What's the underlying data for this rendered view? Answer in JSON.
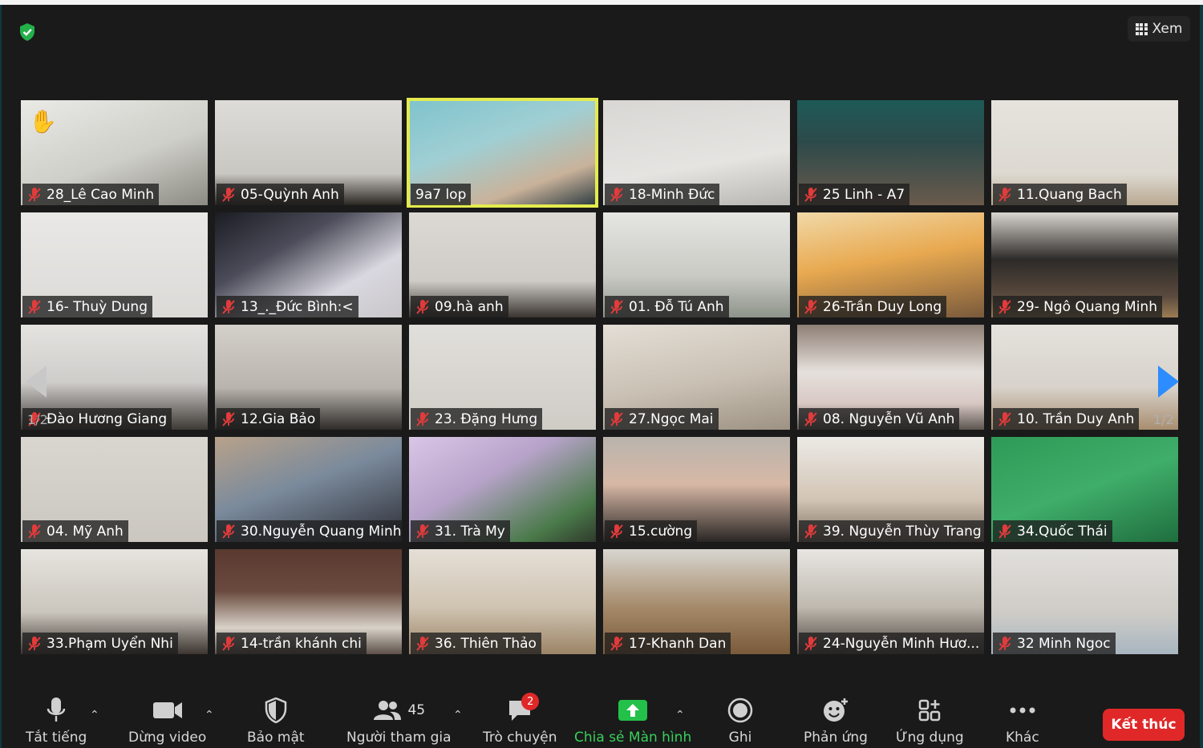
{
  "view_label": "Xem",
  "page_indicator": "1/2",
  "tiles": [
    {
      "name": "28_Lê Cao Minh",
      "bg": "linear-gradient(160deg,#e9e9e6 0%,#cfcfc9 55%,#8b8a83 100%)",
      "hand": true
    },
    {
      "name": "05-Quỳnh Anh",
      "bg": "linear-gradient(180deg,#dedcd8 0%,#c9c7c2 70%,#2a2622 100%)"
    },
    {
      "name": "9a7 lop",
      "bg": "linear-gradient(160deg,#7fc3cc 0%,#9fcfd4 40%,#c9b29a 75%,#2c3b40 100%)",
      "active": true
    },
    {
      "name": "18-Minh Đức",
      "bg": "linear-gradient(170deg,#d9d7d4 0%,#e6e4e1 60%,#b8b6b2 100%)"
    },
    {
      "name": "25 Linh - A7",
      "bg": "linear-gradient(180deg,#1d5a57 0%,#2d4a4a 40%,#6a5a4c 100%)"
    },
    {
      "name": "11.Quang Bach",
      "bg": "linear-gradient(180deg,#e6e3dd 0%,#ddd9d1 70%,#b9a991 100%)"
    },
    {
      "name": "16- Thuỳ Dung",
      "bg": "linear-gradient(180deg,#e9e8e6 0%,#dcdad7 100%)"
    },
    {
      "name": "13_._Đức Bình:<",
      "bg": "linear-gradient(150deg,#1c1c24 0%,#4c4c5a 35%,#d9d8e0 70%,#c8c6c8 100%)"
    },
    {
      "name": "09.hà anh",
      "bg": "linear-gradient(180deg,#dcd9d5 0%,#cfccc8 65%,#3a3430 100%)"
    },
    {
      "name": "01. Đỗ Tú Anh",
      "bg": "linear-gradient(180deg,#e6e6e2 0%,#c9cac4 60%,#8f948b 100%)"
    },
    {
      "name": "26-Trần Duy Long",
      "bg": "linear-gradient(170deg,#f1d9a8 0%,#e8a950 45%,#7a5a3c 100%)"
    },
    {
      "name": "29- Ngô Quang Minh",
      "bg": "linear-gradient(180deg,#d9d5cf 0%,#2c2a28 45%,#5b4a3e 80%,#9b7d54 100%)"
    },
    {
      "name": "Đào Hương Giang",
      "bg": "linear-gradient(180deg,#e4e3e0 0%,#cfcdca 55%,#3d3935 100%)"
    },
    {
      "name": "12.Gia Bảo",
      "bg": "linear-gradient(180deg,#d4d0ca 0%,#b9b4ad 60%,#2e2b29 100%)"
    },
    {
      "name": "23. Đặng Hưng",
      "bg": "linear-gradient(180deg,#e1dfdb 0%,#cfccc6 100%)"
    },
    {
      "name": "27.Ngọc Mai",
      "bg": "linear-gradient(170deg,#e3ded6 0%,#c9c0b3 55%,#9d9283 100%)"
    },
    {
      "name": "08. Nguyễn Vũ Anh",
      "bg": "linear-gradient(180deg,#8d7f74 0%,#e6e0dc 45%,#d8c8c4 75%,#5c5550 100%)"
    },
    {
      "name": "10. Trần Duy Anh",
      "bg": "linear-gradient(180deg,#e5e2dd 0%,#d7d2ca 60%,#a88d6e 100%)"
    },
    {
      "name": "04. Mỹ Anh",
      "bg": "linear-gradient(180deg,#d9d6d0 0%,#cbc7c0 100%)"
    },
    {
      "name": "30.Nguyễn Quang Minh",
      "bg": "linear-gradient(160deg,#b8a28a 0%,#7a8a9c 45%,#2d2d35 100%)"
    },
    {
      "name": "31. Trà My",
      "bg": "linear-gradient(150deg,#d9c6e6 0%,#b7a3c9 40%,#4a7a4a 80%,#2f3a2c 100%)"
    },
    {
      "name": "15.cường",
      "bg": "linear-gradient(180deg,#b9b4ad 0%,#d7b8a6 45%,#2a2624 100%)"
    },
    {
      "name": "39. Nguyễn Thùy Trang",
      "bg": "linear-gradient(180deg,#eceae6 0%,#d2c4b4 60%,#7a6e62 100%)"
    },
    {
      "name": "34.Quốc Thái",
      "bg": "linear-gradient(160deg,#2f9a57 0%,#3fae6a 50%,#1f6e3e 100%)"
    },
    {
      "name": "33.Phạm Uyển Nhi",
      "bg": "linear-gradient(180deg,#e6e4df 0%,#cbc6bd 60%,#3c3531 100%)"
    },
    {
      "name": "14-trần khánh chi",
      "bg": "linear-gradient(180deg,#5a3a30 0%,#6a4a3e 40%,#d8d2c8 75%,#5c5048 100%)"
    },
    {
      "name": "36. Thiên Thảo",
      "bg": "linear-gradient(180deg,#e4dfd7 0%,#d0c4b2 55%,#9b8466 100%)"
    },
    {
      "name": "17-Khanh Dan",
      "bg": "linear-gradient(180deg,#d8d6d0 0%,#a58a6a 55%,#7a5a3a 100%)"
    },
    {
      "name": "24-Nguyễn Minh Hươ...",
      "bg": "linear-gradient(180deg,#e8e6e2 0%,#bfb9af 55%,#4a443d 100%)"
    },
    {
      "name": "32 Minh Ngoc",
      "bg": "linear-gradient(180deg,#e1dfdc 0%,#cfccc7 60%,#a8b6c0 100%)"
    }
  ],
  "toolbar": {
    "mute": "Tắt tiếng",
    "video": "Dừng video",
    "security": "Bảo mật",
    "participants": "Người tham gia",
    "participants_count": "45",
    "chat": "Trò chuyện",
    "chat_badge": "2",
    "share": "Chia sẻ Màn hình",
    "record": "Ghi",
    "reactions": "Phản ứng",
    "apps": "Ứng dụng",
    "more": "Khác",
    "end": "Kết thúc"
  },
  "colors": {
    "active_speaker": "#e4eb4e",
    "share_green": "#37d05a",
    "end_red": "#e02828",
    "accent_blue": "#2d8cff"
  }
}
